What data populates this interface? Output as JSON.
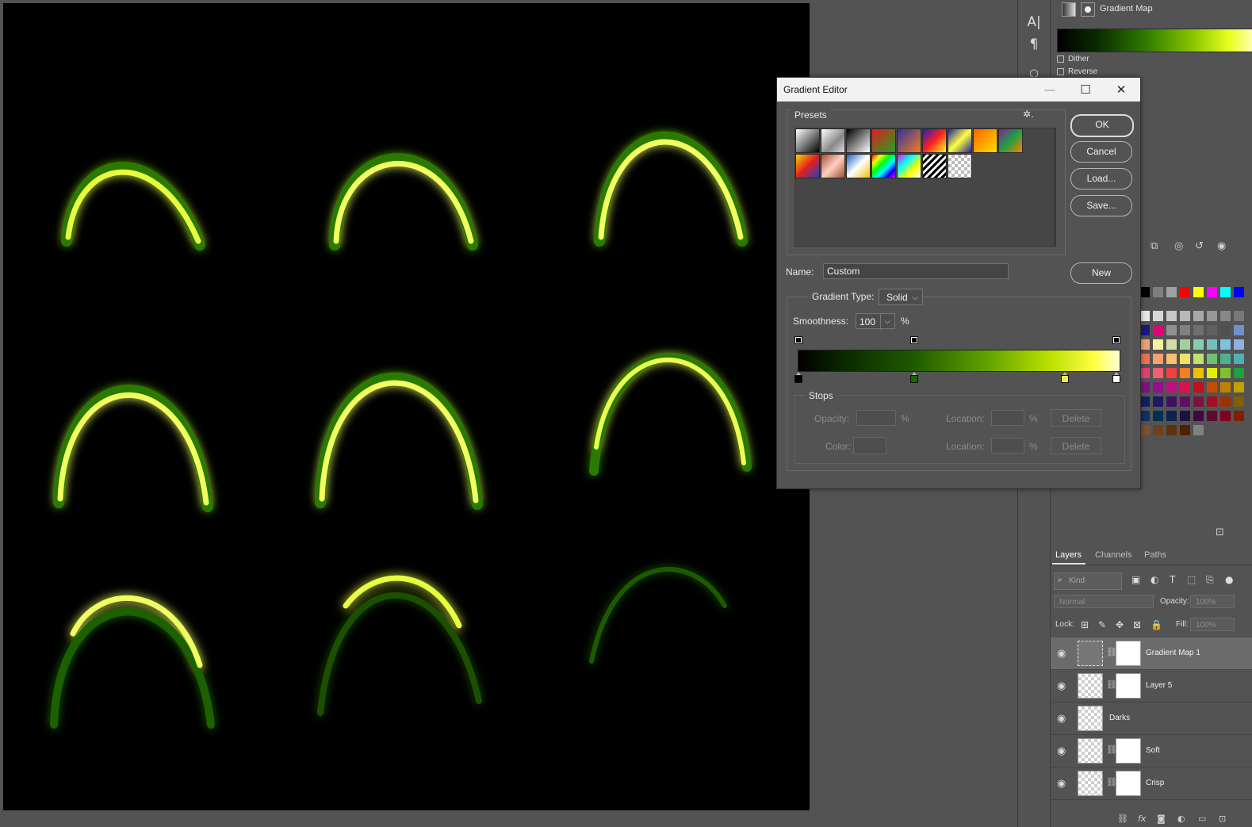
{
  "dialog": {
    "title": "Gradient Editor",
    "presets_label": "Presets",
    "buttons": {
      "ok": "OK",
      "cancel": "Cancel",
      "load": "Load...",
      "save": "Save...",
      "new": "New"
    },
    "name_label": "Name:",
    "name_value": "Custom",
    "gradient_type_label": "Gradient Type:",
    "gradient_type_value": "Solid",
    "smoothness_label": "Smoothness:",
    "smoothness_value": "100",
    "smoothness_unit": "%",
    "stops": {
      "label": "Stops",
      "opacity_label": "Opacity:",
      "color_label": "Color:",
      "location_label": "Location:",
      "percent": "%",
      "delete_label": "Delete"
    },
    "color_stops": [
      "#000000",
      "#1e6400",
      "#f0f040",
      "#ffffff"
    ]
  },
  "properties": {
    "title": "Gradient Map",
    "dither_label": "Dither",
    "reverse_label": "Reverse"
  },
  "layers_panel": {
    "tabs": [
      "Layers",
      "Channels",
      "Paths"
    ],
    "kind_placeholder": "Kind",
    "blend_mode": "Normal",
    "opacity_label": "Opacity:",
    "opacity_value": "100%",
    "lock_label": "Lock:",
    "fill_label": "Fill:",
    "fill_value": "100%",
    "layers": [
      {
        "name": "Gradient Map 1"
      },
      {
        "name": "Layer 5"
      },
      {
        "name": "Darks"
      },
      {
        "name": "Soft"
      },
      {
        "name": "Crisp"
      }
    ]
  },
  "icons": {
    "text_tool": "type-icon",
    "paragraph_tool": "paragraph-icon",
    "settings": "gear-icon",
    "visibility": "eye-icon"
  },
  "colors": {
    "accent_green": "#8cc800",
    "panel_bg": "#535353"
  }
}
